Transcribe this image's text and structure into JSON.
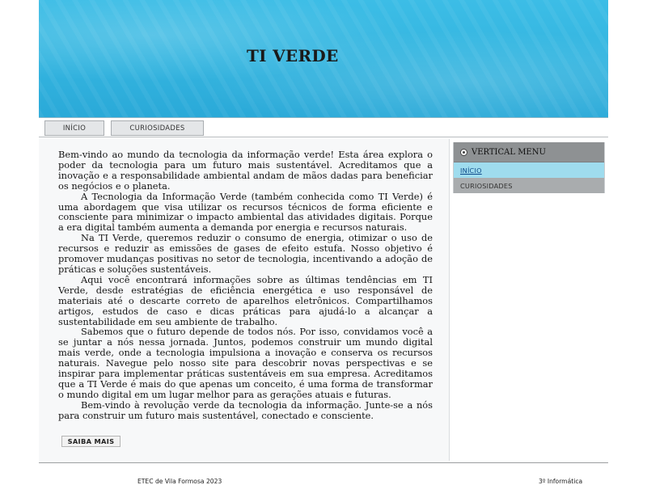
{
  "header": {
    "title": "TI VERDE"
  },
  "nav": {
    "tabs": [
      {
        "label": "INÍCIO"
      },
      {
        "label": "CURIOSIDADES"
      }
    ]
  },
  "article": {
    "paragraphs": [
      "Bem-vindo ao mundo da tecnologia da informação verde! Esta área explora o poder da tecnologia para um futuro mais sustentável. Acreditamos que a inovação e a responsabilidade ambiental andam de mãos dadas para beneficiar os negócios e o planeta.",
      "A Tecnologia da Informação Verde (também conhecida como TI Verde) é uma abordagem que visa utilizar os recursos técnicos de forma eficiente e consciente para minimizar o impacto ambiental das atividades digitais. Porque a era digital também aumenta a demanda por energia e recursos naturais.",
      "Na TI Verde, queremos reduzir o consumo de energia, otimizar o uso de recursos e reduzir as emissões de gases de efeito estufa. Nosso objetivo é promover mudanças positivas no setor de tecnologia, incentivando a adoção de práticas e soluções sustentáveis.",
      "Aqui você encontrará informações sobre as últimas tendências em TI Verde, desde estratégias de eficiência energética e uso responsável de materiais até o descarte correto de aparelhos eletrônicos. Compartilhamos artigos, estudos de caso e dicas práticas para ajudá-lo a alcançar a sustentabilidade em seu ambiente de trabalho.",
      "Sabemos que o futuro depende de todos nós. Por isso, convidamos você a se juntar a nós nessa jornada. Juntos, podemos construir um mundo digital mais verde, onde a tecnologia impulsiona a inovação e conserva os recursos naturais. Navegue pelo nosso site para descobrir novas perspectivas e se inspirar para implementar práticas sustentáveis em sua empresa. Acreditamos que a TI Verde é mais do que apenas um conceito, é uma forma de transformar o mundo digital em um lugar melhor para as gerações atuais e futuras.",
      "Bem-vindo à revolução verde da tecnologia da informação. Junte-se a nós para construir um futuro mais sustentável, conectado e consciente."
    ],
    "more_button": "SAIBA MAIS"
  },
  "sidebar": {
    "header": "VERTICAL MENU",
    "header_icon": "bullet-icon",
    "items": [
      {
        "label": "INÍCIO",
        "active": true
      },
      {
        "label": "CURIOSIDADES",
        "active": false
      }
    ]
  },
  "footer": {
    "left": "ETEC de Vila Formosa 2023",
    "right": "3º Informática"
  },
  "colors": {
    "banner": "#34b5e0",
    "active_menu": "#9fdcee",
    "menu_header": "#8e9193"
  }
}
